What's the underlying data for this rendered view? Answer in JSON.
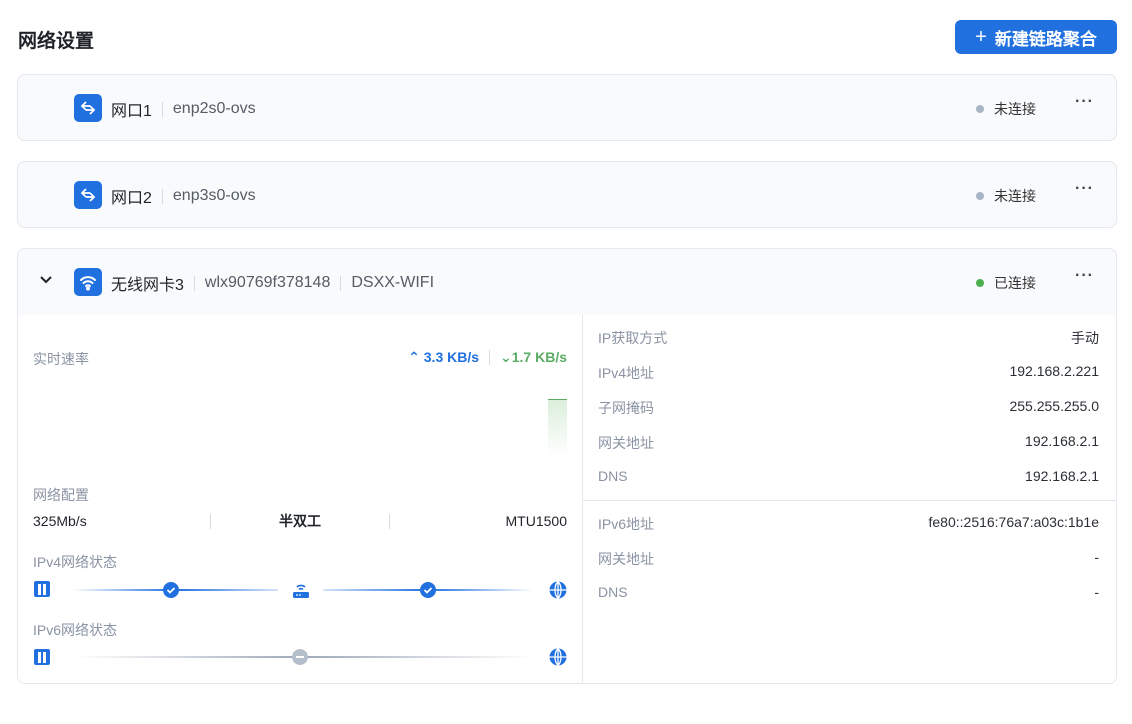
{
  "page": {
    "title": "网络设置",
    "new_button": "新建链路聚合"
  },
  "colors": {
    "accent": "#2070e0",
    "connected": "#4caf50",
    "disconnected": "#a9b4c6",
    "upload": "#2070e0",
    "download": "#5aad63"
  },
  "interfaces": [
    {
      "name": "网口1",
      "device": "enp2s0-ovs",
      "status": "未连接",
      "icon": "ethernet-arrows-icon"
    },
    {
      "name": "网口2",
      "device": "enp3s0-ovs",
      "status": "未连接",
      "icon": "ethernet-arrows-icon"
    },
    {
      "name": "无线网卡3",
      "device": "wlx90769f378148",
      "ssid": "DSXX-WIFI",
      "status": "已连接",
      "icon": "wifi-icon",
      "details": {
        "speed_label": "实时速率",
        "upload": "3.3 KB/s",
        "download": "1.7 KB/s",
        "config_label": "网络配置",
        "link_speed": "325Mb/s",
        "duplex": "半双工",
        "mtu": "MTU1500",
        "ipv4_status_label": "IPv4网络状态",
        "ipv6_status_label": "IPv6网络状态",
        "ipv4": [
          {
            "k": "IP获取方式",
            "v": "手动"
          },
          {
            "k": "IPv4地址",
            "v": "192.168.2.221"
          },
          {
            "k": "子网掩码",
            "v": "255.255.255.0"
          },
          {
            "k": "网关地址",
            "v": "192.168.2.1"
          },
          {
            "k": "DNS",
            "v": "192.168.2.1"
          }
        ],
        "ipv6": [
          {
            "k": "IPv6地址",
            "v": "fe80::2516:76a7:a03c:1b1e"
          },
          {
            "k": "网关地址",
            "v": "-"
          },
          {
            "k": "DNS",
            "v": "-"
          }
        ]
      }
    }
  ]
}
